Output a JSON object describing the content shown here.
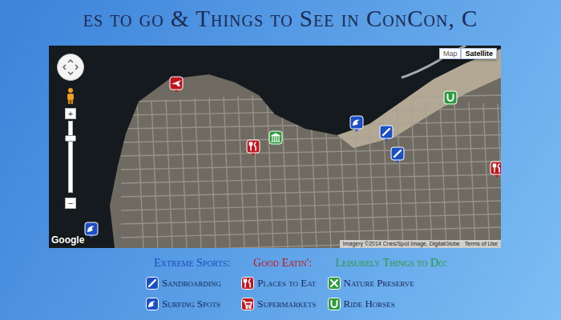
{
  "page": {
    "title": "es to go & Things to See in ConCon, C"
  },
  "map": {
    "type_buttons": [
      {
        "label": "Map",
        "selected": false
      },
      {
        "label": "Satellite",
        "selected": true
      }
    ],
    "zoom": {
      "level": 0.79,
      "plus": "+",
      "minus": "−"
    },
    "logo": "Google",
    "attribution": "Imagery ©2014 Cnes/Spot Image, DigitalGlobe",
    "terms": "Terms of Use",
    "pins": [
      {
        "kind": "airport",
        "color": "#c0161e"
      },
      {
        "kind": "museum",
        "color": "#2f9a3c"
      },
      {
        "kind": "eat",
        "color": "#c0161e"
      },
      {
        "kind": "surfing",
        "color": "#1d4fc4"
      },
      {
        "kind": "sandboarding",
        "color": "#1d4fc4"
      },
      {
        "kind": "sandboarding",
        "color": "#1d4fc4"
      },
      {
        "kind": "horse",
        "color": "#2f9a3c"
      },
      {
        "kind": "eat",
        "color": "#c0161e"
      },
      {
        "kind": "surfing",
        "color": "#1d4fc4"
      }
    ]
  },
  "legend": {
    "columns": [
      {
        "heading": "Extreme Sports:",
        "color": "#1d4fc4",
        "items": [
          {
            "label": "Sandboarding",
            "kind": "sandboarding"
          },
          {
            "label": "Surfing Spots",
            "kind": "surfing"
          }
        ]
      },
      {
        "heading": "Good Eatin':",
        "color": "#c0161e",
        "items": [
          {
            "label": "Places to Eat",
            "kind": "eat"
          },
          {
            "label": "Supermarkets",
            "kind": "supermarket"
          }
        ]
      },
      {
        "heading": "Leisurely Things to Do:",
        "color": "#2f9a3c",
        "items": [
          {
            "label": "Nature Preserve",
            "kind": "nature"
          },
          {
            "label": "Ride Horses",
            "kind": "horse"
          }
        ]
      }
    ]
  }
}
